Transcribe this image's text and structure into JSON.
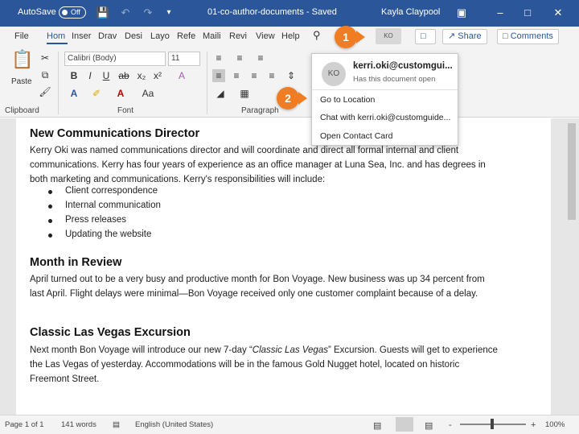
{
  "titlebar": {
    "autosave": "AutoSave",
    "toggle": "Off",
    "doc_title": "01-co-author-documents - Saved",
    "user": "Kayla Claypool",
    "icons": {
      "save": "save-icon",
      "undo": "undo-icon",
      "redo": "redo-icon",
      "ribbon_display": "ribbon-display-icon",
      "minimize": "minimize-icon",
      "maximize": "maximize-icon",
      "close": "close-icon"
    }
  },
  "tabs": [
    "File",
    "Home",
    "Insert",
    "Draw",
    "Design",
    "Layout",
    "References",
    "Mailings",
    "Review",
    "View",
    "Help"
  ],
  "tab_display": [
    "File",
    "Hom",
    "Inser",
    "Drav",
    "Desi",
    "Layo",
    "Refe",
    "Maili",
    "Revi",
    "View",
    "Help"
  ],
  "header": {
    "avatar": "KO",
    "share": "Share",
    "comments": "Comments",
    "search_icon": "search-icon"
  },
  "ribbon": {
    "clipboard": "Clipboard",
    "paste": "Paste",
    "font_group": "Font",
    "paragraph_group": "Paragraph",
    "font_name": "Calibri (Body)",
    "font_size": "11",
    "icons": [
      "bold-icon",
      "italic-icon",
      "underline-icon",
      "strikethrough-icon",
      "subscript-icon",
      "superscript-icon",
      "clear-format-icon",
      "text-effects-icon",
      "highlight-icon",
      "font-color-icon",
      "change-case-icon",
      "bullets-icon",
      "numbering-icon",
      "align-left-icon",
      "center-icon",
      "align-right-icon",
      "justify-icon",
      "line-spacing-icon",
      "shading-icon",
      "borders-icon",
      "cut-icon",
      "copy-icon",
      "format-painter-icon"
    ]
  },
  "popup": {
    "avatar": "KO",
    "name": "kerri.oki@customgui...",
    "status": "Has this document open",
    "items": [
      "Go to Location",
      "Chat with kerri.oki@customguide...",
      "Open Contact Card"
    ]
  },
  "callouts": [
    "1",
    "2"
  ],
  "doc": {
    "h1": "New Communications Director",
    "p1": "Kerry Oki was named communications director and will coordinate and direct all formal internal and client communications. Kerry has four years of experience as an office manager at Luna Sea, Inc. and has degrees in both marketing and communications. Kerry's responsibilities will include:",
    "bullets": [
      "Client correspondence",
      "Internal communication",
      "Press releases",
      "Updating the website"
    ],
    "h2": "Month in Review",
    "p2": "April turned out to be a very busy and productive month for Bon Voyage. New business was up 34 percent from last April. Flight delays were minimal—Bon Voyage received only one customer complaint because of a delay.",
    "h3": "Classic Las Vegas Excursion",
    "p3_a": "Next month Bon Voyage will introduce our new 7-day “",
    "p3_em": "Classic Las Vegas",
    "p3_b": "” Excursion. Guests will get to experience the Las Vegas of yesterday. Accommodations will be in the famous Gold Nugget hotel, located on historic Freemont Street."
  },
  "status": {
    "page": "Page 1 of 1",
    "words": "141 words",
    "language": "English (United States)",
    "zoom": "100%",
    "minus": "-",
    "plus": "+"
  },
  "colors": {
    "brand": "#2b579a",
    "callout": "#f07d23"
  }
}
